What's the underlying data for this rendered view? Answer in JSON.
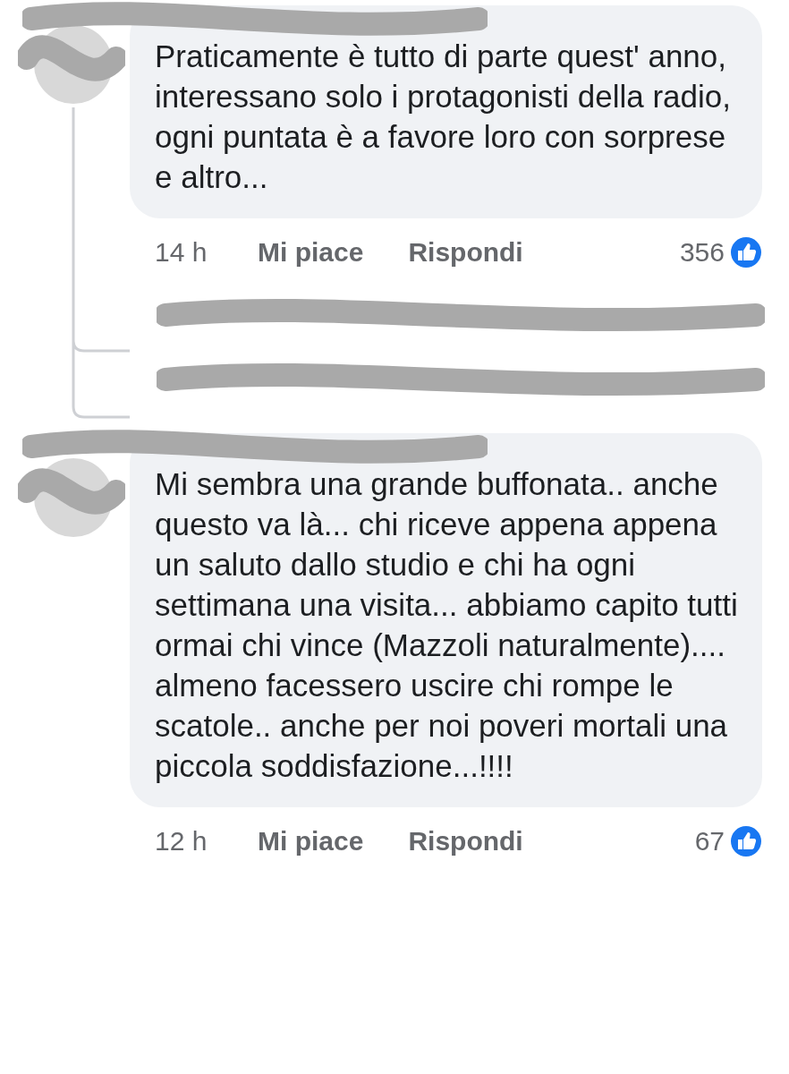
{
  "comments": [
    {
      "text": "Praticamente è tutto di parte quest' anno, interessano solo i protagonisti della radio, ogni puntata è a favore loro con sorprese e altro...",
      "time": "14 h",
      "like_label": "Mi piace",
      "reply_label": "Rispondi",
      "reactions": "356",
      "reply_rows": [
        {
          "kind": "redacted"
        },
        {
          "kind": "redacted"
        }
      ]
    },
    {
      "text": "Mi sembra una grande buffonata.. anche questo va là... chi riceve appena appena un saluto dallo studio e chi ha ogni settimana una visita... abbiamo capito tutti ormai chi vince (Mazzoli naturalmente).... almeno facessero uscire chi rompe le scatole.. anche per noi poveri mortali una piccola soddisfazione...!!!!",
      "time": "12 h",
      "like_label": "Mi piace",
      "reply_label": "Rispondi",
      "reactions": "67"
    }
  ]
}
